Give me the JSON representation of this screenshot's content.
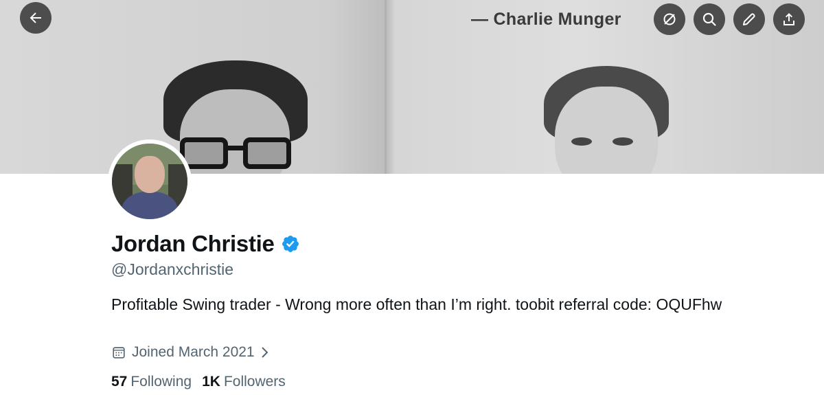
{
  "banner": {
    "quote": "— Charlie Munger"
  },
  "toolbar": {
    "back_icon": "arrow-left-icon",
    "grok_icon": "slash-circle-icon",
    "search_icon": "search-icon",
    "edit_icon": "pencil-icon",
    "share_icon": "share-upload-icon"
  },
  "profile": {
    "name": "Jordan Christie",
    "handle": "@Jordanxchristie",
    "bio": "Profitable Swing trader - Wrong more often than I’m right. toobit referral code: OQUFhw",
    "joined": "Joined March 2021",
    "following_count": "57",
    "following_label": "Following",
    "followers_count": "1K",
    "followers_label": "Followers"
  },
  "colors": {
    "verified": "#1d9bf0",
    "text_primary": "#0f1419",
    "text_secondary": "#536471"
  }
}
